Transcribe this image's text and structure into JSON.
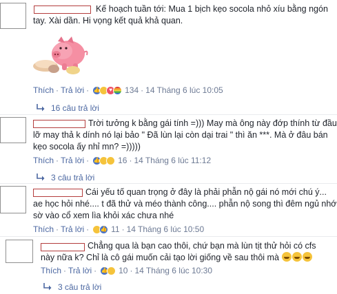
{
  "comments": [
    {
      "lines": [
        "Kế hoạch tuần tới: Mua 1 bịch kẹo socola nhỏ xíu bằng ngón",
        "tay. Xài dần. Hi vọng kết quả khả quan."
      ],
      "like": "Thích",
      "reply": "Trả lời",
      "count": "134",
      "time": "14 Tháng 6 lúc 10:05",
      "reactions": [
        "like",
        "haha",
        "love",
        "pride"
      ],
      "replies": "16 câu trả lời"
    },
    {
      "lines": [
        "Trời tưởng k bằng gái tính =))) May mà ông này đớp thính từ đầu,",
        "lỡ may thả k dính nó lại bảo \" Đã lùn lại còn dại trai \" thì ăn ***. Mà ở đâu bán",
        "kẹo socola ấy nhỉ mn? =)))))"
      ],
      "like": "Thích",
      "reply": "Trả lời",
      "count": "16",
      "time": "14 Tháng 6 lúc 11:12",
      "reactions": [
        "like",
        "haha",
        "wow"
      ],
      "replies": "3 câu trả lời"
    },
    {
      "lines": [
        "Cái yếu tố quan trọng ở đây là phải phẫn nộ gái nó mới chú ý...",
        "ae học hỏi nhé.... t đã thử và méo thành công.... phẫn nộ song thì đêm ngủ nhớ",
        "sờ vào cổ xem lìa khỏi xác chưa nhé"
      ],
      "like": "Thích",
      "reply": "Trả lời",
      "count": "11",
      "time": "14 Tháng 6 lúc 10:50",
      "reactions": [
        "haha",
        "like"
      ]
    },
    {
      "lines": [
        "Chẳng qua là bạn cao thôi, chứ bạn mà lùn tịt thử hỏi có cfs",
        "này nữa k? Chỉ là cô gái muốn cải tạo lời giống về sau thôi mà"
      ],
      "like": "Thích",
      "reply": "Trả lời",
      "count": "10",
      "time": "14 Tháng 6 lúc 10:30",
      "reactions": [
        "like",
        "haha"
      ],
      "replies": "3 câu trả lời"
    }
  ],
  "sticker": "pig-sticker",
  "icons": {
    "replies_arrow": "reply-arrow-icon",
    "laugh": "laughing-emoji-icon"
  },
  "colors": {
    "link": "#4b67a1",
    "meta": "#6d7a94",
    "text": "#1d2129",
    "redact_border": "#b33c3c"
  }
}
